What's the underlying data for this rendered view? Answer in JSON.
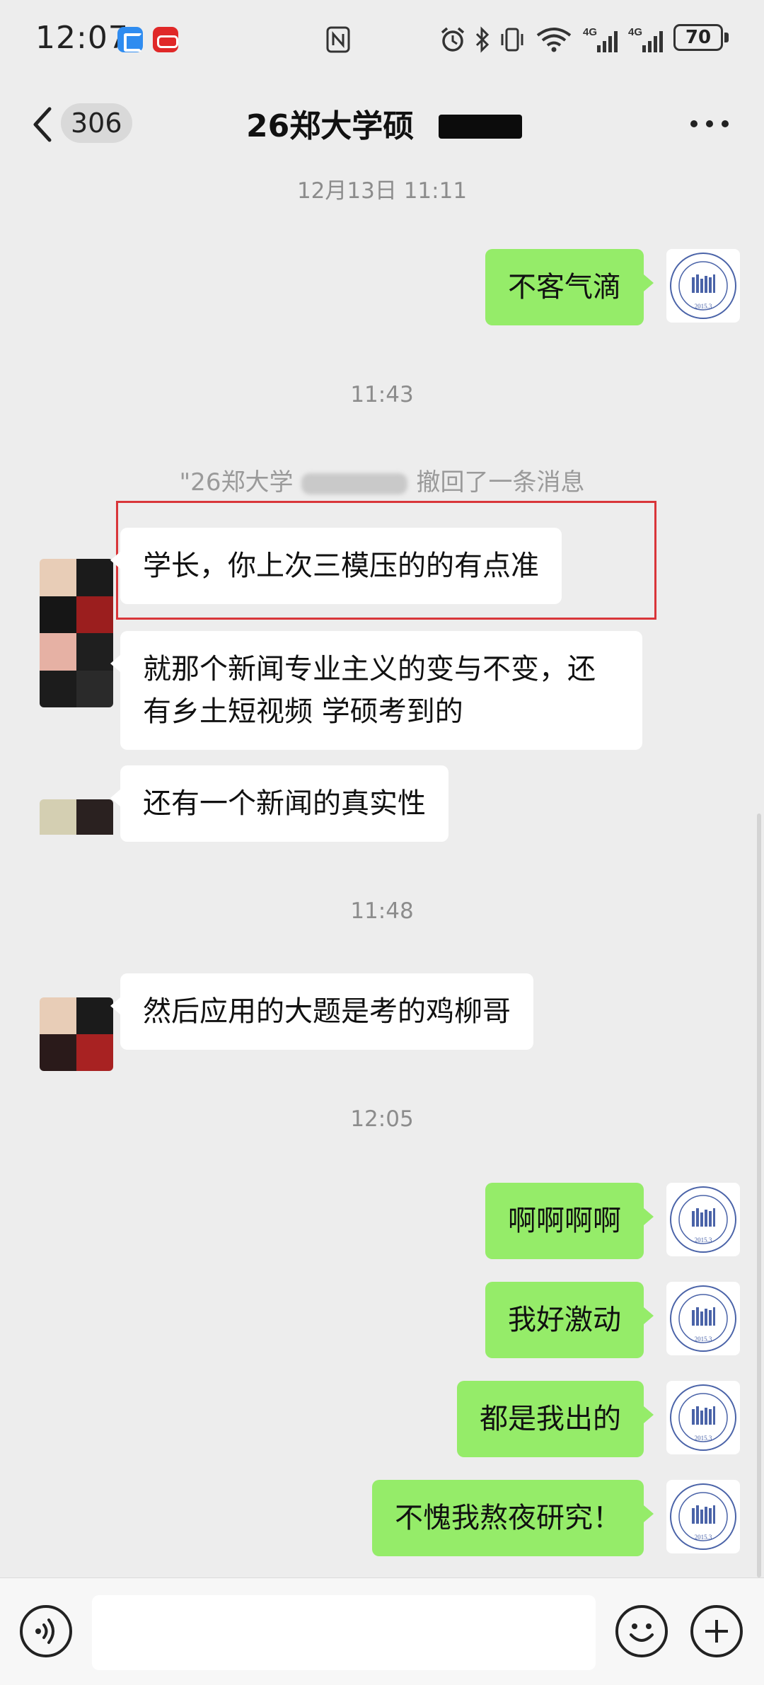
{
  "status_bar": {
    "time": "12:07",
    "signal_labels": [
      "4G",
      "4G"
    ],
    "battery": "70"
  },
  "nav": {
    "unread_count": "306",
    "title": "26郑大学硕"
  },
  "timestamps": [
    "12月13日 11:11",
    "11:43",
    "11:48",
    "12:05"
  ],
  "recall_notice": {
    "prefix": "\"26郑大学",
    "suffix": "撤回了一条消息"
  },
  "messages": [
    {
      "side": "out",
      "text": "不客气滴"
    },
    {
      "side": "in",
      "text": "学长，你上次三模压的的有点准"
    },
    {
      "side": "in",
      "text": "就那个新闻专业主义的变与不变，还有乡土短视频 学硕考到的"
    },
    {
      "side": "in",
      "text": "还有一个新闻的真实性"
    },
    {
      "side": "in",
      "text": "然后应用的大题是考的鸡柳哥"
    },
    {
      "side": "out",
      "text": "啊啊啊啊"
    },
    {
      "side": "out",
      "text": "我好激动"
    },
    {
      "side": "out",
      "text": "都是我出的"
    },
    {
      "side": "out",
      "text": "不愧我熬夜研究！"
    }
  ],
  "avatar_logo": {
    "ring_text": "LUO XUE ZHANG KAO YAN",
    "year": "2015.3",
    "color": "#4a63a8"
  },
  "colors": {
    "background": "#ededed",
    "bubble_out": "#95ec69",
    "bubble_in": "#ffffff",
    "highlight": "#d9363a"
  },
  "input_bar": {
    "placeholder": ""
  }
}
